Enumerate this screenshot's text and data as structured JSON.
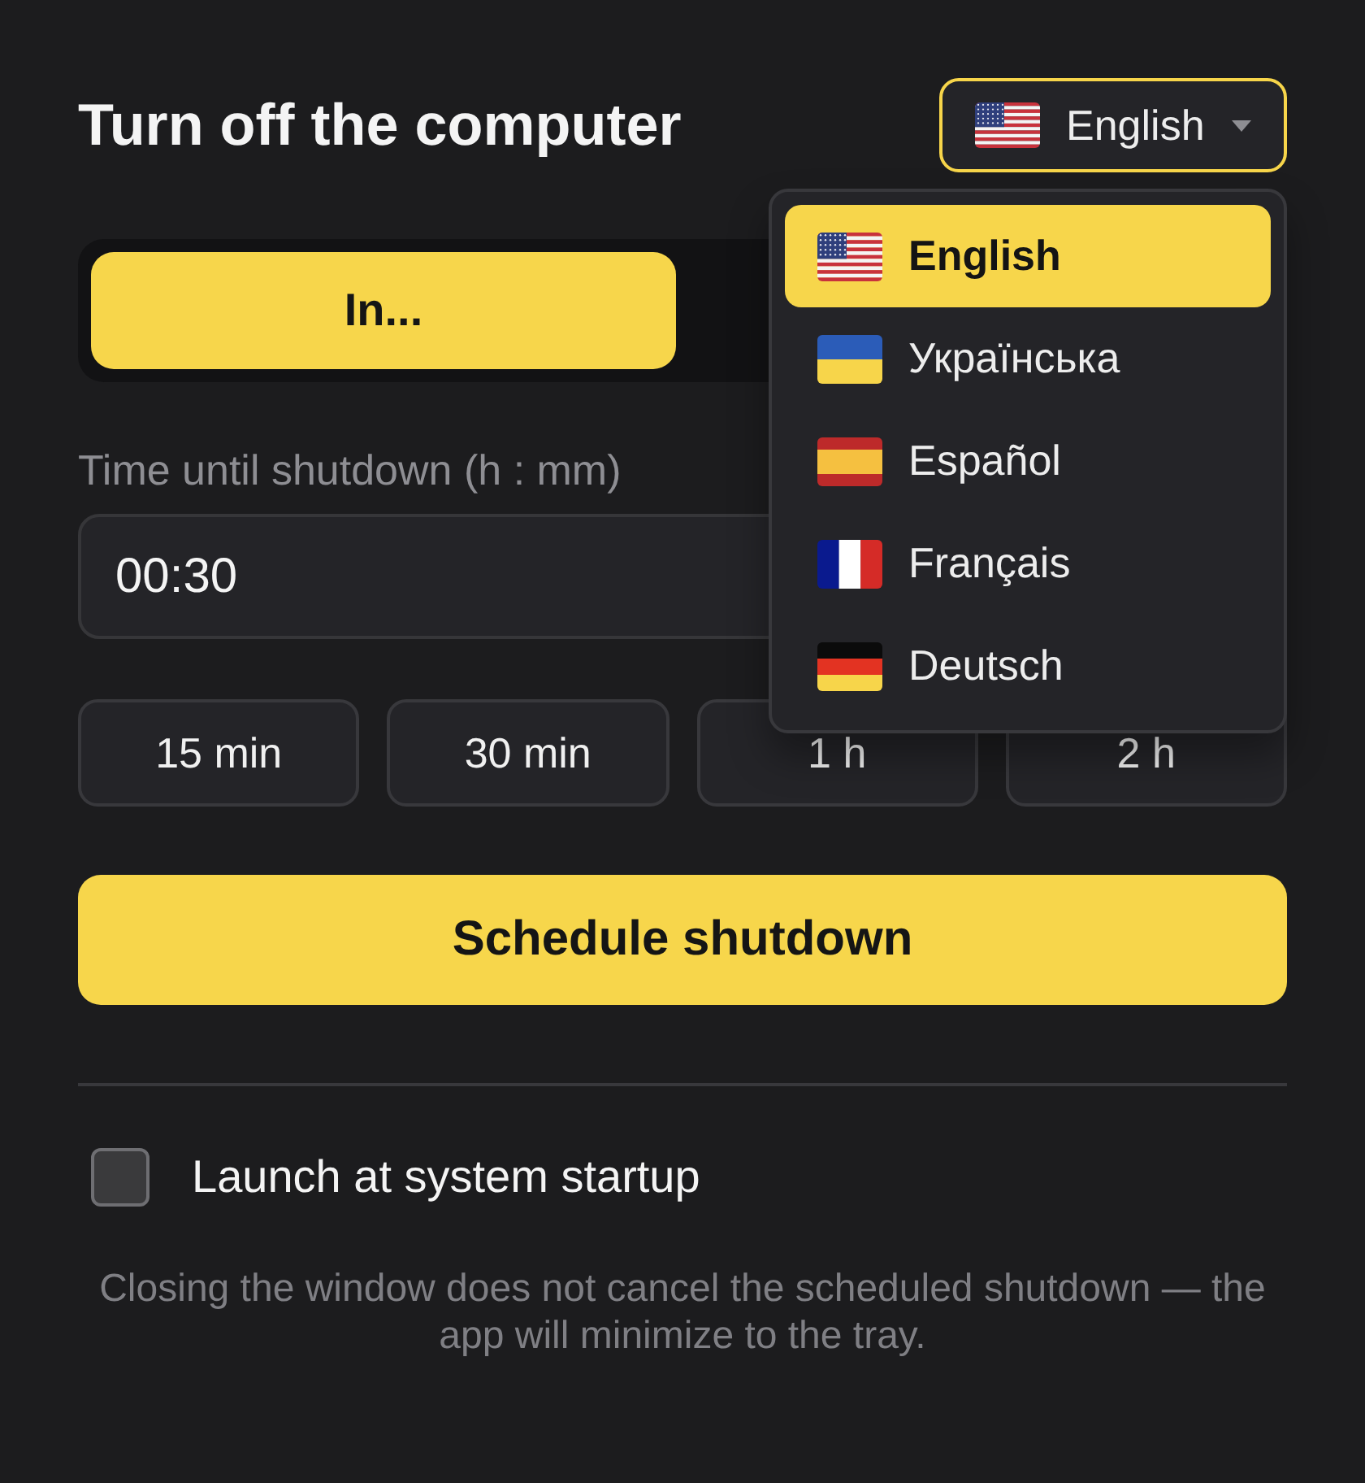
{
  "header": {
    "title": "Turn off the computer",
    "language_button": {
      "kind": "us",
      "label": "English"
    }
  },
  "tabs": [
    {
      "label": "In...",
      "selected": true
    }
  ],
  "time_field": {
    "label": "Time until shutdown (h : mm)",
    "value": "00:30"
  },
  "presets": [
    "15 min",
    "30 min",
    "1 h",
    "2 h"
  ],
  "schedule_button": {
    "label": "Schedule shutdown"
  },
  "startup_option": {
    "label": "Launch at system startup",
    "checked": false
  },
  "note": "Closing the window does not cancel the scheduled shutdown — the app will minimize to the tray.",
  "language_menu": {
    "items": [
      {
        "kind": "us",
        "label": "English",
        "selected": true
      },
      {
        "kind": "ukraine",
        "label": "Українська",
        "selected": false
      },
      {
        "kind": "spain",
        "label": "Español",
        "selected": false
      },
      {
        "kind": "france",
        "label": "Français",
        "selected": false
      },
      {
        "kind": "germany",
        "label": "Deutsch",
        "selected": false
      }
    ]
  }
}
